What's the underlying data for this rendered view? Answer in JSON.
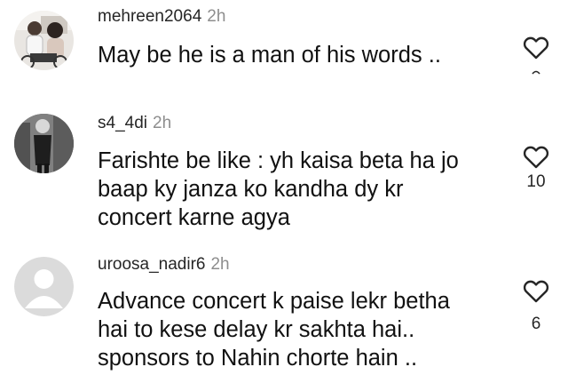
{
  "comments": [
    {
      "username": "mehreen2064",
      "time": "2h",
      "text": "May be he is a man of his words ..",
      "likes": "",
      "avatar_icon": "user-photo-avatar"
    },
    {
      "username": "s4_4di",
      "time": "2h",
      "text": "Farishte be like : yh kaisa beta ha jo\nbaap ky janza ko kandha dy kr\nconcert karne agya",
      "likes": "10",
      "avatar_icon": "user-photo-avatar"
    },
    {
      "username": "uroosa_nadir6",
      "time": "2h",
      "text": "Advance concert k paise lekr betha\nhai to kese delay kr sakhta hai..\nsponsors to Nahin chorte hain ..",
      "likes": "6",
      "avatar_icon": "default-avatar"
    }
  ],
  "icons": {
    "like": "heart-outline-icon"
  },
  "colors": {
    "text": "#111111",
    "username": "#262626",
    "timestamp": "#8e8e8e",
    "default_avatar_bg": "#dbdbdb"
  }
}
